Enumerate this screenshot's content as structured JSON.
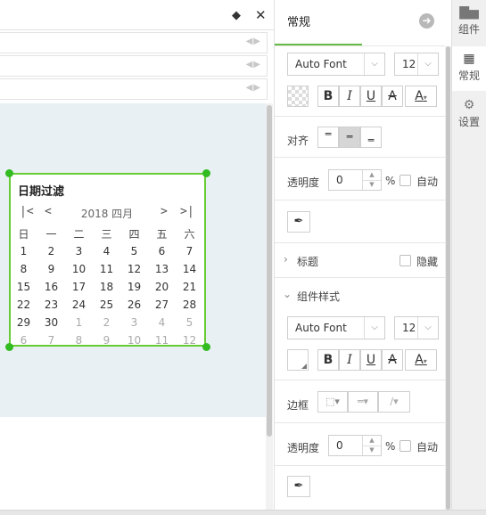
{
  "canvas": {
    "calendar_widget": {
      "title": "日期过滤",
      "nav": {
        "first": "|<",
        "prev": "<",
        "next": ">",
        "last": ">|"
      },
      "month_title": "2018 四月",
      "weekdays": [
        "日",
        "一",
        "二",
        "三",
        "四",
        "五",
        "六"
      ],
      "weeks": [
        [
          {
            "d": "1",
            "out": false
          },
          {
            "d": "2",
            "out": false
          },
          {
            "d": "3",
            "out": false
          },
          {
            "d": "4",
            "out": false
          },
          {
            "d": "5",
            "out": false
          },
          {
            "d": "6",
            "out": false
          },
          {
            "d": "7",
            "out": false
          }
        ],
        [
          {
            "d": "8",
            "out": false
          },
          {
            "d": "9",
            "out": false
          },
          {
            "d": "10",
            "out": false
          },
          {
            "d": "11",
            "out": false
          },
          {
            "d": "12",
            "out": false
          },
          {
            "d": "13",
            "out": false
          },
          {
            "d": "14",
            "out": false
          }
        ],
        [
          {
            "d": "15",
            "out": false
          },
          {
            "d": "16",
            "out": false
          },
          {
            "d": "17",
            "out": false
          },
          {
            "d": "18",
            "out": false
          },
          {
            "d": "19",
            "out": false
          },
          {
            "d": "20",
            "out": false
          },
          {
            "d": "21",
            "out": false
          }
        ],
        [
          {
            "d": "22",
            "out": false
          },
          {
            "d": "23",
            "out": false
          },
          {
            "d": "24",
            "out": false
          },
          {
            "d": "25",
            "out": false
          },
          {
            "d": "26",
            "out": false
          },
          {
            "d": "27",
            "out": false
          },
          {
            "d": "28",
            "out": false
          }
        ],
        [
          {
            "d": "29",
            "out": false
          },
          {
            "d": "30",
            "out": false
          },
          {
            "d": "1",
            "out": true
          },
          {
            "d": "2",
            "out": true
          },
          {
            "d": "3",
            "out": true
          },
          {
            "d": "4",
            "out": true
          },
          {
            "d": "5",
            "out": true
          }
        ],
        [
          {
            "d": "6",
            "out": true
          },
          {
            "d": "7",
            "out": true
          },
          {
            "d": "8",
            "out": true
          },
          {
            "d": "9",
            "out": true
          },
          {
            "d": "10",
            "out": true
          },
          {
            "d": "11",
            "out": true
          },
          {
            "d": "12",
            "out": true
          }
        ]
      ],
      "selection_color": "#66cc33"
    }
  },
  "toolbar": {
    "eraser_icon": "eraser-icon",
    "close_icon": "close-icon"
  },
  "panel": {
    "title": "常规",
    "font": {
      "family": "Auto Font",
      "size": "12"
    },
    "format_buttons": {
      "bold": "B",
      "italic": "I",
      "underline": "U",
      "strike": "A",
      "color": "A"
    },
    "align_label": "对齐",
    "opacity_label": "透明度",
    "opacity_value": "0",
    "percent": "%",
    "auto_label": "自动",
    "title_section": {
      "label": "标题",
      "hide_label": "隐藏"
    },
    "style_section": {
      "label": "组件样式",
      "font": {
        "family": "Auto Font",
        "size": "12"
      },
      "border_label": "边框",
      "opacity_label": "透明度",
      "opacity_value": "0",
      "percent": "%",
      "auto_label": "自动"
    },
    "accent_color": "#66bb44"
  },
  "side_tabs": [
    {
      "label": "组件",
      "icon": "bar-chart-icon"
    },
    {
      "label": "常规",
      "icon": "grid-icon"
    },
    {
      "label": "设置",
      "icon": "gear-icon"
    }
  ]
}
